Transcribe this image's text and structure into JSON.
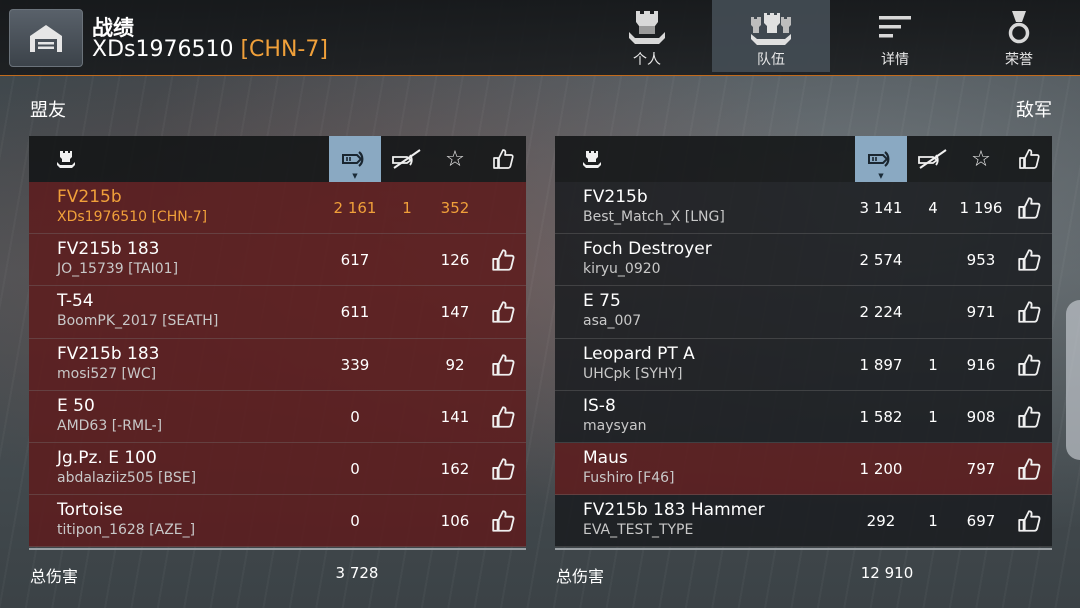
{
  "header": {
    "title": "战绩",
    "player_name": "XDs1976510",
    "player_clan": "[CHN-7]",
    "tabs": [
      {
        "label": "个人",
        "icon": "personal-icon"
      },
      {
        "label": "队伍",
        "icon": "team-icon"
      },
      {
        "label": "详情",
        "icon": "details-icon"
      },
      {
        "label": "荣誉",
        "icon": "honor-medal-icon"
      }
    ],
    "active_tab": "队伍"
  },
  "allies": {
    "title": "盟友",
    "rows": [
      {
        "tank": "FV215b",
        "player": "XDs1976510 [CHN-7]",
        "damage": "2 161",
        "kills": "1",
        "score": "352"
      },
      {
        "tank": "FV215b 183",
        "player": "JO_15739 [TAI01]",
        "damage": "617",
        "kills": "",
        "score": "126"
      },
      {
        "tank": "T-54",
        "player": "BoomPK_2017 [SEATH]",
        "damage": "611",
        "kills": "",
        "score": "147"
      },
      {
        "tank": "FV215b 183",
        "player": "mosi527 [WC]",
        "damage": "339",
        "kills": "",
        "score": "92"
      },
      {
        "tank": "E 50",
        "player": "AMD63 [-RML-]",
        "damage": "0",
        "kills": "",
        "score": "141"
      },
      {
        "tank": "Jg.Pz. E 100",
        "player": "abdalaziiz505 [BSE]",
        "damage": "0",
        "kills": "",
        "score": "162"
      },
      {
        "tank": "Tortoise",
        "player": "titipon_1628 [AZE_]",
        "damage": "0",
        "kills": "",
        "score": "106"
      }
    ],
    "total_label": "总伤害",
    "total_damage": "3 728"
  },
  "enemies": {
    "title": "敌军",
    "rows": [
      {
        "tank": "FV215b",
        "player": "Best_Match_X [LNG]",
        "damage": "3 141",
        "kills": "4",
        "score": "1 196"
      },
      {
        "tank": "Foch Destroyer",
        "player": "kiryu_0920",
        "damage": "2 574",
        "kills": "",
        "score": "953"
      },
      {
        "tank": "E 75",
        "player": "asa_007",
        "damage": "2 224",
        "kills": "",
        "score": "971"
      },
      {
        "tank": "Leopard PT A",
        "player": "UHCpk [SYHY]",
        "damage": "1 897",
        "kills": "1",
        "score": "916"
      },
      {
        "tank": "IS-8",
        "player": "maysyan",
        "damage": "1 582",
        "kills": "1",
        "score": "908"
      },
      {
        "tank": "Maus",
        "player": "Fushiro [F46]",
        "damage": "1 200",
        "kills": "",
        "score": "797"
      },
      {
        "tank": "FV215b 183 Hammer",
        "player": "EVA_TEST_TYPE",
        "damage": "292",
        "kills": "1",
        "score": "697"
      }
    ],
    "total_label": "总伤害",
    "total_damage": "12 910"
  },
  "colors": {
    "accent": "#f0a03a",
    "highlight_row": "#5c1c1e",
    "selected_column": "#8aa9c2"
  }
}
